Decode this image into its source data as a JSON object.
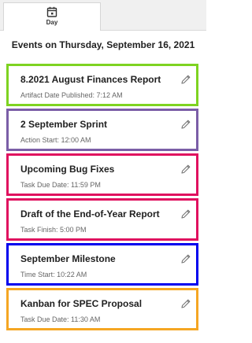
{
  "tab": {
    "label": "Day",
    "icon": "calendar-icon"
  },
  "heading": "Events on Thursday, September 16, 2021",
  "events": [
    {
      "title": "8.2021 August Finances Report",
      "meta": "Artifact Date Published: 7:12 AM",
      "color": "#7ed321"
    },
    {
      "title": "2 September Sprint",
      "meta": "Action Start: 12:00 AM",
      "color": "#7b5ea7"
    },
    {
      "title": "Upcoming Bug Fixes",
      "meta": "Task Due Date: 11:59 PM",
      "color": "#e0115f"
    },
    {
      "title": "Draft of the End-of-Year Report",
      "meta": "Task Finish: 5:00 PM",
      "color": "#e0115f"
    },
    {
      "title": "September Milestone",
      "meta": "Time Start: 10:22 AM",
      "color": "#0000ee"
    },
    {
      "title": "Kanban for SPEC Proposal",
      "meta": "Task Due Date: 11:30 AM",
      "color": "#f5a623"
    }
  ],
  "edit_icon": "pencil-icon"
}
